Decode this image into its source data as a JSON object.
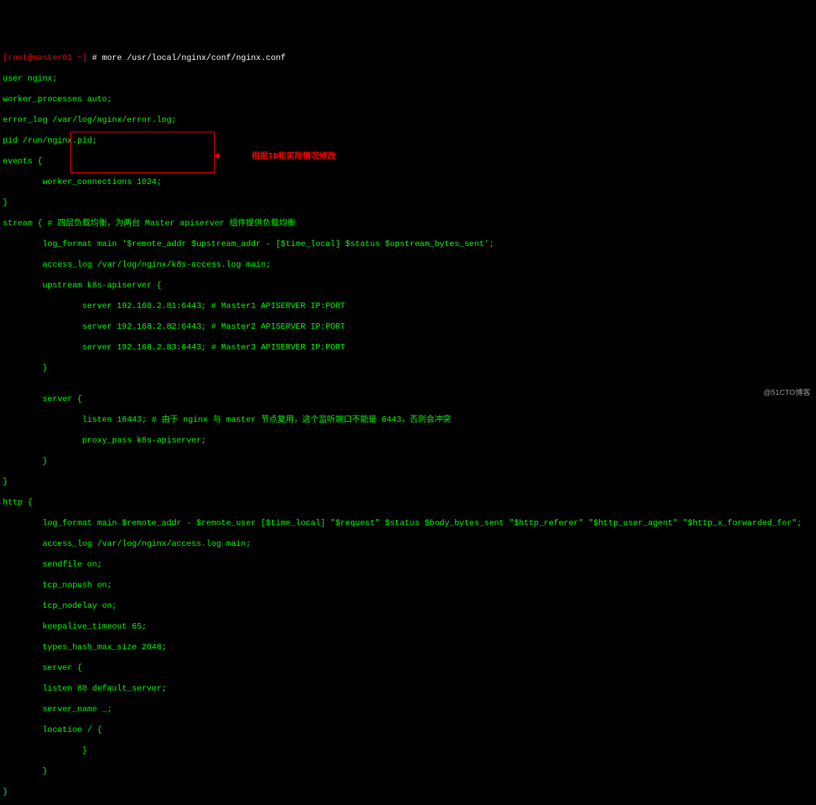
{
  "prompt": {
    "user_host": "[root@master01 ~]",
    "hash": "#",
    "command": "more /usr/local/nginx/conf/nginx.conf"
  },
  "lines": {
    "l1": "user nginx;",
    "l2": "worker_processes auto;",
    "l3": "error_log /var/log/nginx/error.log;",
    "l4": "pid /run/nginx.pid;",
    "l5": "events {",
    "l6": "        worker_connections 1024;",
    "l7": "}",
    "l8": "stream { # 四层负载均衡，为两台 Master apiserver 组件提供负载均衡",
    "l9": "        log_format main '$remote_addr $upstream_addr - [$time_local] $status $upstream_bytes_sent';",
    "l10": "        access_log /var/log/nginx/k8s-access.log main;",
    "l11": "        upstream k8s-apiserver {",
    "l12": "                server 192.168.2.81:6443; # Master1 APISERVER IP:PORT",
    "l13": "                server 192.168.2.82:6443; # Master2 APISERVER IP:PORT",
    "l14": "                server 192.168.2.83:6443; # Master3 APISERVER IP:PORT",
    "l15": "        }",
    "l16": "",
    "l17": "        server {",
    "l18": "                listen 16443; # 由于 nginx 与 master 节点复用，这个监听端口不能是 6443，否则会冲突",
    "l19": "                proxy_pass k8s-apiserver;",
    "l20": "        }",
    "l21": "}",
    "l22": "http {",
    "l23": "        log_format main $remote_addr - $remote_user [$time_local] \"$request\" $status $body_bytes_sent \"$http_referer\" \"$http_user_agent\" \"$http_x_forwarded_for\";",
    "l24": "        access_log /var/log/nginx/access.log main;",
    "l25": "        sendfile on;",
    "l26": "        tcp_nopush on;",
    "l27": "        tcp_nodelay on;",
    "l28": "        keepalive_timeout 65;",
    "l29": "        types_hash_max_size 2048;",
    "l30": "        server {",
    "l31": "        listen 80 default_server;",
    "l32": "        server_name _;",
    "l33": "        location / {",
    "l34": "                }",
    "l35": "        }",
    "l36": "}"
  },
  "annotation": {
    "arrow": "◄",
    "text": "根据ID和实际情况修改"
  },
  "watermark": "@51CTO博客"
}
